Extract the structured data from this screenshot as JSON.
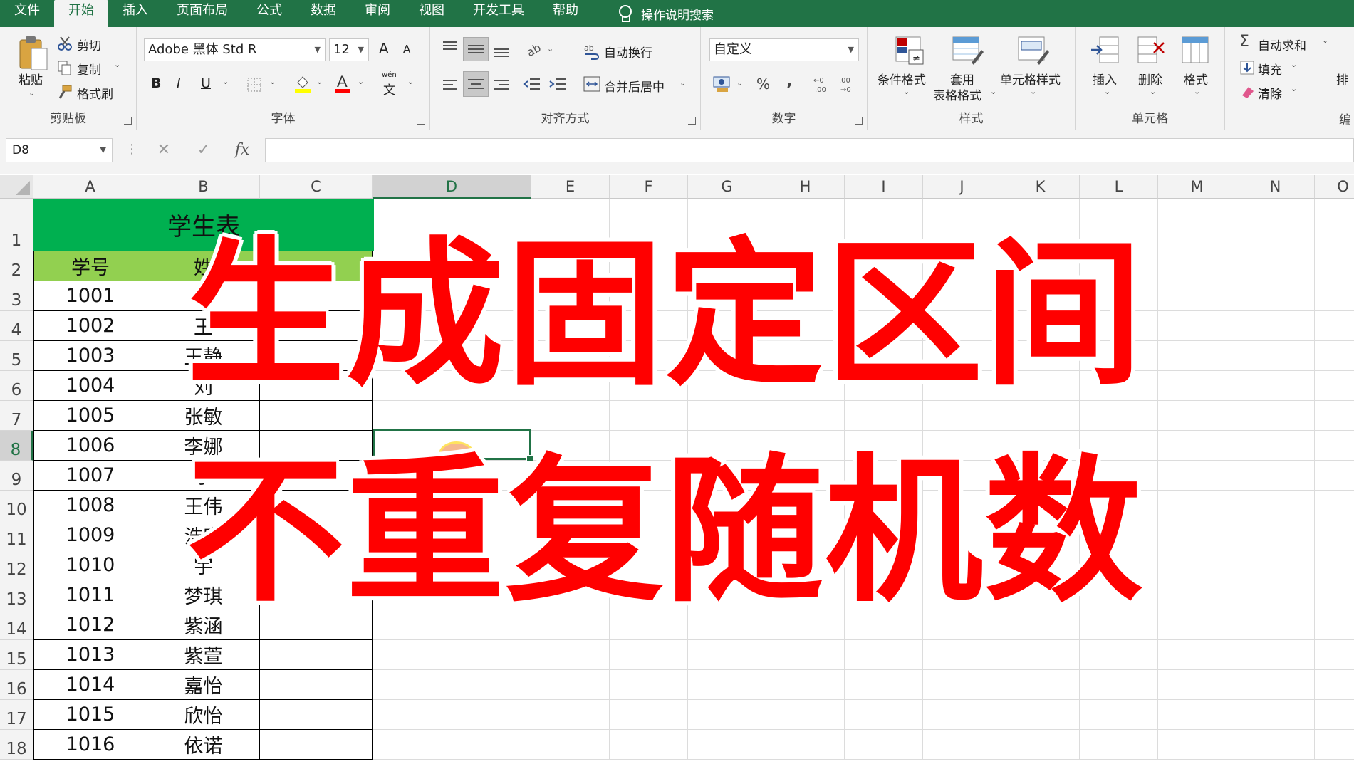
{
  "menu": {
    "items": [
      "文件",
      "开始",
      "插入",
      "页面布局",
      "公式",
      "数据",
      "审阅",
      "视图",
      "开发工具",
      "帮助"
    ],
    "active_index": 1,
    "search_label": "操作说明搜索"
  },
  "ribbon": {
    "clipboard": {
      "paste": "粘贴",
      "cut": "剪切",
      "copy": "复制",
      "format_painter": "格式刷",
      "label": "剪贴板"
    },
    "font": {
      "name": "Adobe 黑体 Std R",
      "size": "12",
      "grow": "A",
      "shrink": "A",
      "bold": "B",
      "italic": "I",
      "underline": "U",
      "phonetic": "文",
      "phonetic_top": "wén",
      "label": "字体"
    },
    "alignment": {
      "wrap": "自动换行",
      "merge": "合并后居中",
      "label": "对齐方式"
    },
    "number": {
      "format": "自定义",
      "percent": "%",
      "comma": ",",
      "label": "数字"
    },
    "styles": {
      "conditional": "条件格式",
      "table_format_1": "套用",
      "table_format_2": "表格格式",
      "cell_styles": "单元格样式",
      "label": "样式"
    },
    "cells": {
      "insert": "插入",
      "delete": "删除",
      "format": "格式",
      "label": "单元格"
    },
    "editing": {
      "autosum": "自动求和",
      "fill": "填充",
      "clear": "清除",
      "sort_partial": "排",
      "label_partial": "编"
    }
  },
  "formula_bar": {
    "name_box": "D8",
    "cancel": "✕",
    "enter": "✓",
    "fx": "fx",
    "value": ""
  },
  "columns": [
    "A",
    "B",
    "C",
    "D",
    "E",
    "F",
    "G",
    "H",
    "I",
    "J",
    "K",
    "L",
    "M",
    "N",
    "O"
  ],
  "selected_column": "D",
  "rows": [
    "1",
    "2",
    "3",
    "4",
    "5",
    "6",
    "7",
    "8",
    "9",
    "10",
    "11",
    "12",
    "13",
    "14",
    "15",
    "16",
    "17",
    "18"
  ],
  "selected_row": "8",
  "table": {
    "title": "学生表",
    "headers": [
      "学号",
      "姓"
    ],
    "ids": [
      "1001",
      "1002",
      "1003",
      "1004",
      "1005",
      "1006",
      "1007",
      "1008",
      "1009",
      "1010",
      "1011",
      "1012",
      "1013",
      "1014",
      "1015",
      "1016"
    ],
    "names": [
      "张",
      "王",
      "王静",
      "刘",
      "张敏",
      "李娜",
      "李",
      "王伟",
      "浩宇",
      "宇",
      "梦琪",
      "紫涵",
      "紫萱",
      "嘉怡",
      "欣怡",
      "依诺"
    ]
  },
  "overlay": {
    "line1": "生成固定区间",
    "line2": "不重复随机数"
  },
  "colors": {
    "excel_green": "#217346",
    "title_fill": "#00b050",
    "header_fill": "#92d050",
    "overlay_red": "#ff0000"
  }
}
